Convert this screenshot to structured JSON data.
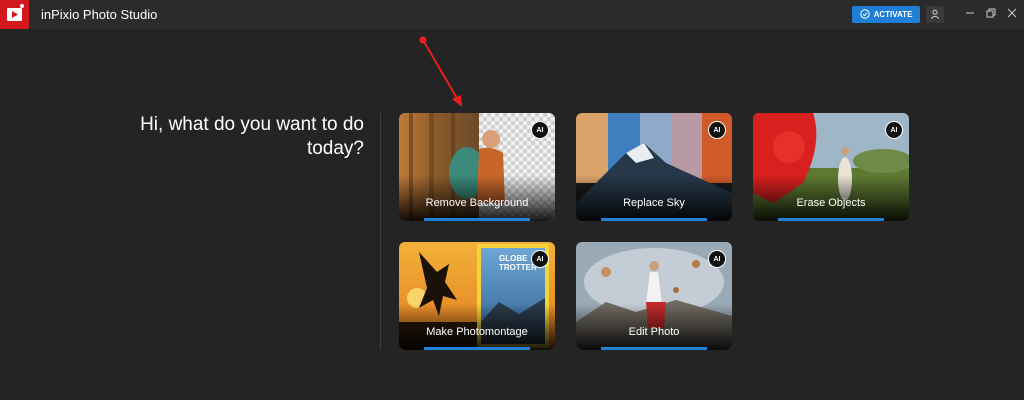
{
  "app": {
    "title": "inPixio Photo Studio",
    "activate_label": "ACTIVATE",
    "accent_color": "#1e82d8",
    "brand_color": "#d3171f"
  },
  "heading": {
    "line1": "Hi, what do you want to do",
    "line2": "today?"
  },
  "cards": [
    {
      "label": "Remove Background",
      "badge": "AI"
    },
    {
      "label": "Replace Sky",
      "badge": "AI"
    },
    {
      "label": "Erase Objects",
      "badge": "AI"
    },
    {
      "label": "Make Photomontage",
      "badge": "AI",
      "magazine_text_1": "GLOBE",
      "magazine_text_2": "TROTTER"
    },
    {
      "label": "Edit Photo",
      "badge": "AI"
    }
  ],
  "icons": [
    "app-logo-icon",
    "check-circle-icon",
    "user-icon",
    "minimize-icon",
    "restore-icon",
    "close-icon",
    "red-arrow-annotation"
  ]
}
